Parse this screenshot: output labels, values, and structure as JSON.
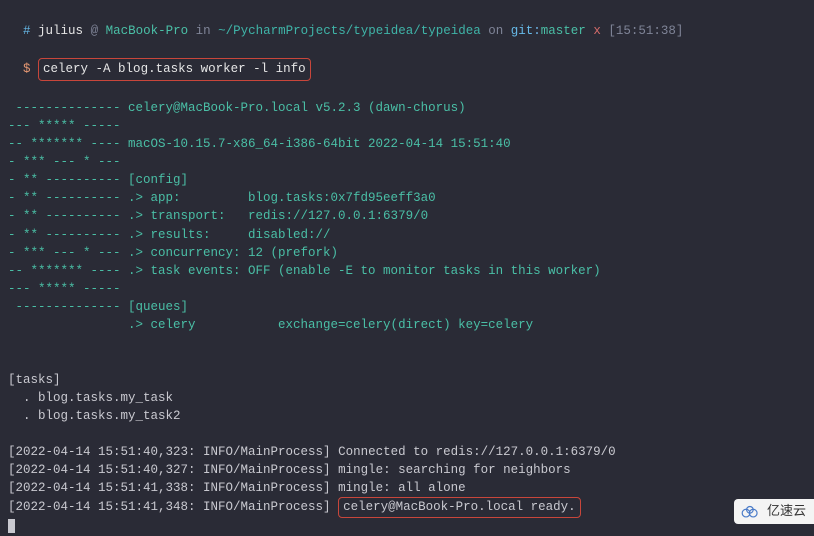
{
  "prompt": {
    "hash": "#",
    "user": "julius",
    "at": "@",
    "host": "MacBook-Pro",
    "in": "in",
    "path": "~/PycharmProjects/typeidea/typeidea",
    "on": "on",
    "git": "git",
    "colon": ":",
    "branch": "master",
    "x": "x",
    "time": "[15:51:38]"
  },
  "command_prefix": "$",
  "command": "celery -A blog.tasks worker -l info",
  "banner_lines": [
    " -------------- celery@MacBook-Pro.local v5.2.3 (dawn-chorus)",
    "--- ***** -----",
    "-- ******* ---- macOS-10.15.7-x86_64-i386-64bit 2022-04-14 15:51:40",
    "- *** --- * ---",
    "- ** ---------- [config]",
    "- ** ---------- .> app:         blog.tasks:0x7fd95eeff3a0",
    "- ** ---------- .> transport:   redis://127.0.0.1:6379/0",
    "- ** ---------- .> results:     disabled://",
    "- *** --- * --- .> concurrency: 12 (prefork)",
    "-- ******* ---- .> task events: OFF (enable -E to monitor tasks in this worker)",
    "--- ***** -----",
    " -------------- [queues]",
    "                .> celery           exchange=celery(direct) key=celery"
  ],
  "tasks_header": "[tasks]",
  "tasks": [
    "  . blog.tasks.my_task",
    "  . blog.tasks.my_task2"
  ],
  "logs": [
    {
      "prefix": "[2022-04-14 15:51:40,323: INFO/MainProcess]",
      "msg": " Connected to redis://127.0.0.1:6379/0",
      "boxed": false
    },
    {
      "prefix": "[2022-04-14 15:51:40,327: INFO/MainProcess]",
      "msg": " mingle: searching for neighbors",
      "boxed": false
    },
    {
      "prefix": "[2022-04-14 15:51:41,338: INFO/MainProcess]",
      "msg": " mingle: all alone",
      "boxed": false
    },
    {
      "prefix": "[2022-04-14 15:51:41,348: INFO/MainProcess]",
      "msg": "celery@MacBook-Pro.local ready.",
      "boxed": true
    }
  ],
  "watermark": "亿速云"
}
